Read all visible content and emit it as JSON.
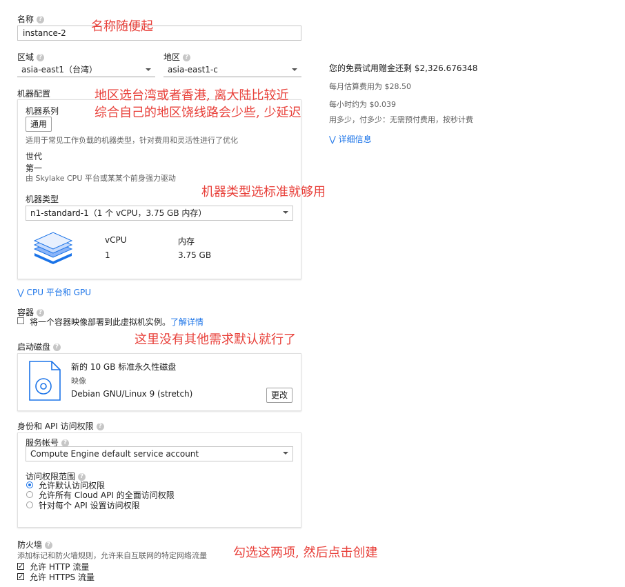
{
  "form": {
    "name": {
      "label": "名称",
      "value": "instance-2"
    },
    "region": {
      "label": "区域",
      "value": "asia-east1（台湾）"
    },
    "zone": {
      "label": "地区",
      "value": "asia-east1-c"
    },
    "machine_config": {
      "label": "机器配置",
      "family_label": "机器系列",
      "family_button": "通用",
      "family_desc": "适用于常见工作负载的机器类型，针对费用和灵活性进行了优化",
      "generation_label": "世代",
      "generation_value": "第一",
      "generation_desc": "由 Skylake CPU 平台或某某个前身强力驱动",
      "type_label": "机器类型",
      "type_value": "n1-standard-1（1 个 vCPU，3.75 GB 内存）",
      "vcpu_label": "vCPU",
      "vcpu_value": "1",
      "memory_label": "内存",
      "memory_value": "3.75 GB"
    },
    "cpu_gpu_link": "CPU 平台和 GPU",
    "container": {
      "label": "容器",
      "checkbox_label": "将一个容器映像部署到此虚拟机实例。",
      "learn_more": "了解详情"
    },
    "boot_disk": {
      "label": "启动磁盘",
      "title": "新的 10 GB 标准永久性磁盘",
      "image_label": "映像",
      "image_value": "Debian GNU/Linux 9 (stretch)",
      "change_button": "更改"
    },
    "identity": {
      "label": "身份和 API 访问权限",
      "service_account_label": "服务帐号",
      "service_account_value": "Compute Engine default service account",
      "scope_label": "访问权限范围",
      "scope_options": [
        "允许默认访问权限",
        "允许所有 Cloud API 的全面访问权限",
        "针对每个 API 设置访问权限"
      ],
      "scope_selected": 0
    },
    "firewall": {
      "label": "防火墙",
      "desc": "添加标记和防火墙规则，允许来自互联网的特定网络流量",
      "http": "允许 HTTP 流量",
      "https": "允许 HTTPS 流量"
    }
  },
  "pricing": {
    "credit": "您的免费试用赠金还剩 $2,326.676348",
    "monthly": "每月估算费用为 $28.50",
    "hourly": "每小时约为 $0.039",
    "note": "用多少，付多少：无需预付费用，按秒计费",
    "details_link": "详细信息"
  },
  "annotations": {
    "name": "名称随便起",
    "region_line1": "地区选台湾或者香港, 离大陆比较近",
    "region_line2": "综合自己的地区饶线路会少些, 少延迟",
    "machine": "机器类型选标准就够用",
    "disk": "这里没有其他需求默认就行了",
    "firewall": "勾选这两项, 然后点击创建"
  },
  "colors": {
    "annotation": "#e8403a",
    "link": "#1a73e8"
  }
}
